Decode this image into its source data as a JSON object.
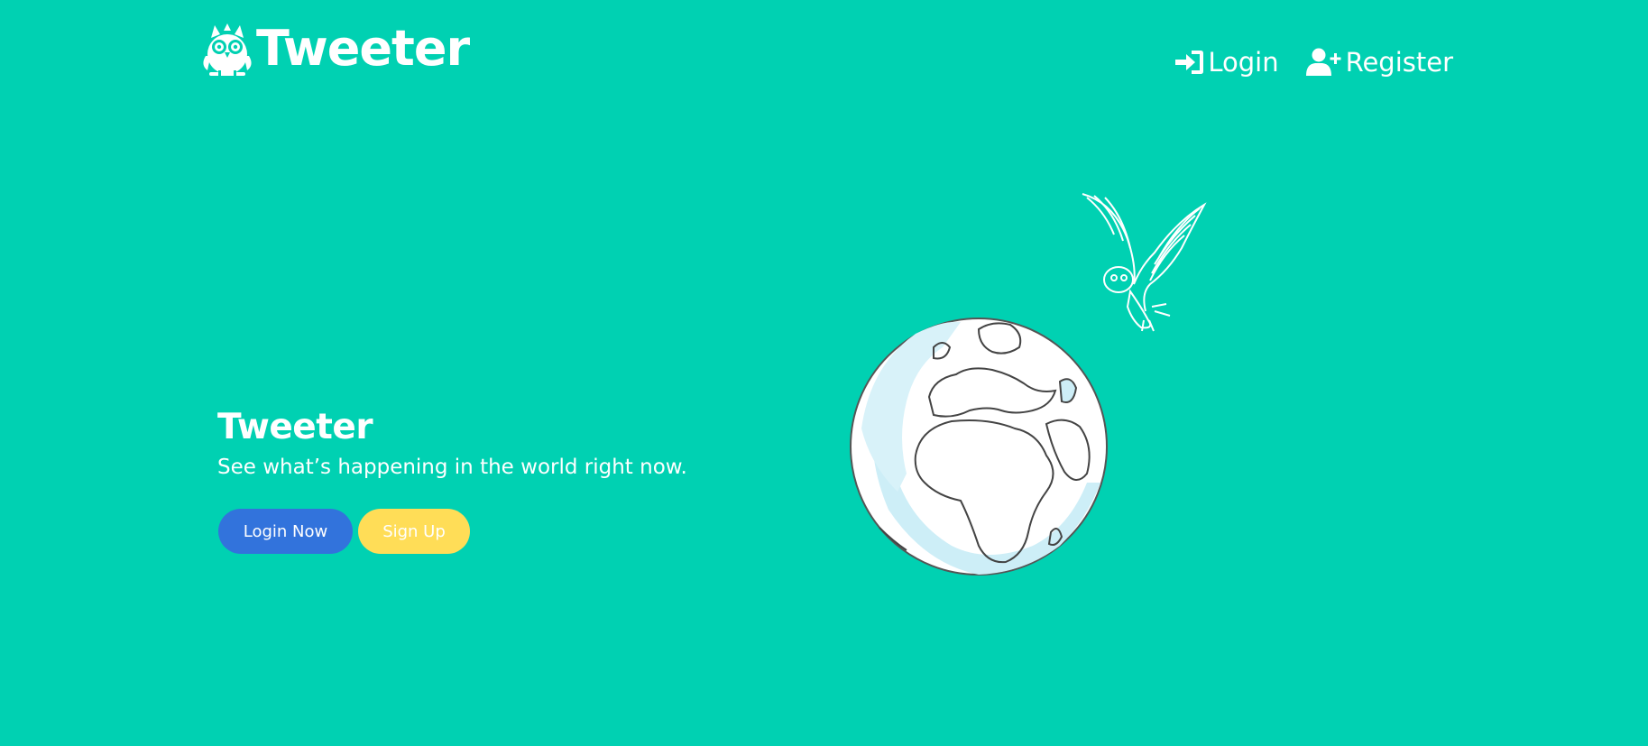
{
  "brand": {
    "name": "Tweeter"
  },
  "nav": {
    "login_label": "Login",
    "register_label": "Register"
  },
  "hero": {
    "title": "Tweeter",
    "subtitle": "See what’s happening in the world right now.",
    "login_button": "Login Now",
    "signup_button": "Sign Up"
  },
  "colors": {
    "background": "#00d1b2",
    "login_button": "#3273dc",
    "signup_button": "#ffdd57",
    "text": "#ffffff"
  },
  "icons": {
    "brand": "owl-logo-icon",
    "login": "sign-in-icon",
    "register": "user-plus-icon",
    "illustration": "globe-with-owl-illustration"
  }
}
